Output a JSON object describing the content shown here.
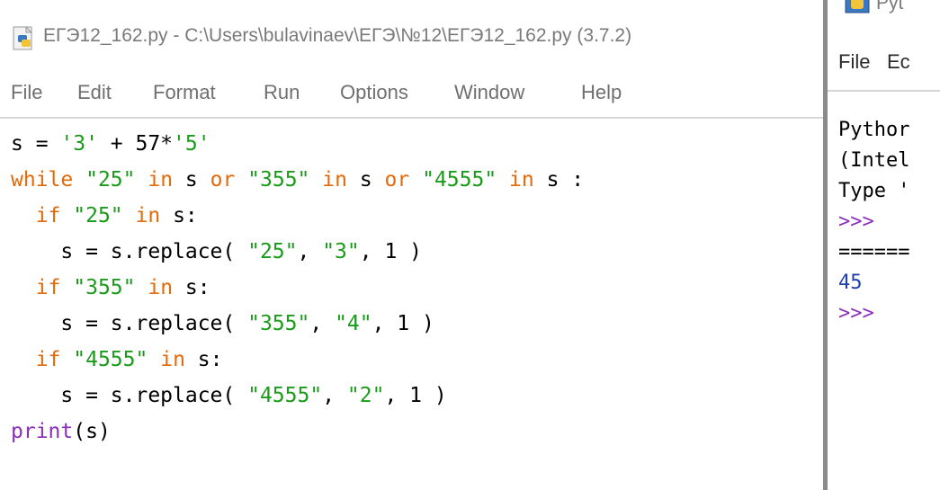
{
  "editor": {
    "title": "ЕГЭ12_162.py - C:\\Users\\bulavinaev\\ЕГЭ\\№12\\ЕГЭ12_162.py (3.7.2)",
    "menu": [
      "File",
      "Edit",
      "Format",
      "Run",
      "Options",
      "Window",
      "Help"
    ],
    "code": [
      {
        "indent": "",
        "t": [
          {
            "c": "s = ",
            "k": "plain"
          },
          {
            "c": "'3'",
            "k": "str"
          },
          {
            "c": " + 57*",
            "k": "plain"
          },
          {
            "c": "'5'",
            "k": "str"
          }
        ]
      },
      {
        "indent": "",
        "t": [
          {
            "c": "while",
            "k": "kw"
          },
          {
            "c": " ",
            "k": "plain"
          },
          {
            "c": "\"25\"",
            "k": "str"
          },
          {
            "c": " ",
            "k": "plain"
          },
          {
            "c": "in",
            "k": "kw"
          },
          {
            "c": " s ",
            "k": "plain"
          },
          {
            "c": "or",
            "k": "kw"
          },
          {
            "c": " ",
            "k": "plain"
          },
          {
            "c": "\"355\"",
            "k": "str"
          },
          {
            "c": " ",
            "k": "plain"
          },
          {
            "c": "in",
            "k": "kw"
          },
          {
            "c": " s ",
            "k": "plain"
          },
          {
            "c": "or",
            "k": "kw"
          },
          {
            "c": " ",
            "k": "plain"
          },
          {
            "c": "\"4555\"",
            "k": "str"
          },
          {
            "c": " ",
            "k": "plain"
          },
          {
            "c": "in",
            "k": "kw"
          },
          {
            "c": " s :",
            "k": "plain"
          }
        ]
      },
      {
        "indent": "  ",
        "t": [
          {
            "c": "if",
            "k": "kw"
          },
          {
            "c": " ",
            "k": "plain"
          },
          {
            "c": "\"25\"",
            "k": "str"
          },
          {
            "c": " ",
            "k": "plain"
          },
          {
            "c": "in",
            "k": "kw"
          },
          {
            "c": " s:",
            "k": "plain"
          }
        ]
      },
      {
        "indent": "    ",
        "t": [
          {
            "c": "s = s.replace( ",
            "k": "plain"
          },
          {
            "c": "\"25\"",
            "k": "str"
          },
          {
            "c": ", ",
            "k": "plain"
          },
          {
            "c": "\"3\"",
            "k": "str"
          },
          {
            "c": ", 1 )",
            "k": "plain"
          }
        ]
      },
      {
        "indent": "  ",
        "t": [
          {
            "c": "if",
            "k": "kw"
          },
          {
            "c": " ",
            "k": "plain"
          },
          {
            "c": "\"355\"",
            "k": "str"
          },
          {
            "c": " ",
            "k": "plain"
          },
          {
            "c": "in",
            "k": "kw"
          },
          {
            "c": " s:",
            "k": "plain"
          }
        ]
      },
      {
        "indent": "    ",
        "t": [
          {
            "c": "s = s.replace( ",
            "k": "plain"
          },
          {
            "c": "\"355\"",
            "k": "str"
          },
          {
            "c": ", ",
            "k": "plain"
          },
          {
            "c": "\"4\"",
            "k": "str"
          },
          {
            "c": ", 1 )",
            "k": "plain"
          }
        ]
      },
      {
        "indent": "  ",
        "t": [
          {
            "c": "if",
            "k": "kw"
          },
          {
            "c": " ",
            "k": "plain"
          },
          {
            "c": "\"4555\"",
            "k": "str"
          },
          {
            "c": " ",
            "k": "plain"
          },
          {
            "c": "in",
            "k": "kw"
          },
          {
            "c": " s:",
            "k": "plain"
          }
        ]
      },
      {
        "indent": "    ",
        "t": [
          {
            "c": "s = s.replace( ",
            "k": "plain"
          },
          {
            "c": "\"4555\"",
            "k": "str"
          },
          {
            "c": ", ",
            "k": "plain"
          },
          {
            "c": "\"2\"",
            "k": "str"
          },
          {
            "c": ", 1 )",
            "k": "plain"
          }
        ]
      },
      {
        "indent": "",
        "t": [
          {
            "c": "print",
            "k": "builtin"
          },
          {
            "c": "(s)",
            "k": "plain"
          }
        ]
      }
    ]
  },
  "shell": {
    "title": "Pyt",
    "menu": [
      "File",
      "Ec"
    ],
    "lines": [
      {
        "c": "Pythor",
        "k": "plain"
      },
      {
        "c": "(Intel",
        "k": "plain"
      },
      {
        "c": "Type '",
        "k": "plain"
      },
      {
        "c": ">>>",
        "k": "prompt"
      },
      {
        "c": "======",
        "k": "plain"
      },
      {
        "c": "45",
        "k": "out"
      },
      {
        "c": ">>>",
        "k": "prompt"
      }
    ]
  },
  "colors": {
    "string": "#1a9b1a",
    "keyword": "#e36a0a",
    "builtin": "#8a2fb8",
    "output": "#1f3fae",
    "prompt": "#8a2fb8",
    "divider": "#8a8a8a"
  },
  "icons": {
    "editor_title": "python-file-icon",
    "shell_title": "python-shell-icon"
  }
}
